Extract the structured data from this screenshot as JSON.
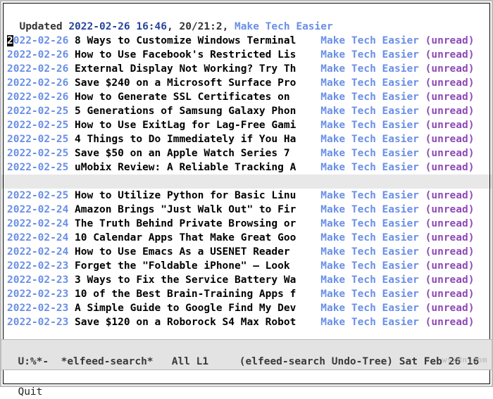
{
  "header": {
    "label": "Updated",
    "timestamp": "2022-02-26 16:46",
    "count": "20/21:2",
    "feed": "Make Tech Easier"
  },
  "columns": {
    "date": 10,
    "title": 40,
    "feed": 17
  },
  "entries": [
    {
      "date": "2022-02-26",
      "title": "8 Ways to Customize Windows Terminal",
      "feed": "Make Tech Easier",
      "status": "(unread)"
    },
    {
      "date": "2022-02-26",
      "title": "How to Use Facebook's Restricted Lis",
      "feed": "Make Tech Easier",
      "status": "(unread)"
    },
    {
      "date": "2022-02-26",
      "title": "External Display Not Working? Try Th",
      "feed": "Make Tech Easier",
      "status": "(unread)"
    },
    {
      "date": "2022-02-26",
      "title": "Save $240 on a Microsoft Surface Pro",
      "feed": "Make Tech Easier",
      "status": "(unread)"
    },
    {
      "date": "2022-02-26",
      "title": "How to Generate SSL Certificates on",
      "feed": "Make Tech Easier",
      "status": "(unread)"
    },
    {
      "date": "2022-02-25",
      "title": "5 Generations of Samsung Galaxy Phon",
      "feed": "Make Tech Easier",
      "status": "(unread)"
    },
    {
      "date": "2022-02-25",
      "title": "How to Use ExitLag for Lag-Free Gami",
      "feed": "Make Tech Easier",
      "status": "(unread)"
    },
    {
      "date": "2022-02-25",
      "title": "4 Things to Do Immediately if You Ha",
      "feed": "Make Tech Easier",
      "status": "(unread)"
    },
    {
      "date": "2022-02-25",
      "title": "Save $50 on an Apple Watch Series 7",
      "feed": "Make Tech Easier",
      "status": "(unread)"
    },
    {
      "date": "2022-02-25",
      "title": "uMobix Review: A Reliable Tracking A",
      "feed": "Make Tech Easier",
      "status": "(unread)"
    }
  ],
  "selected_gap": true,
  "entries2": [
    {
      "date": "2022-02-25",
      "title": "How to Utilize Python for Basic Linu",
      "feed": "Make Tech Easier",
      "status": "(unread)"
    },
    {
      "date": "2022-02-24",
      "title": "Amazon Brings \"Just Walk Out\" to Fir",
      "feed": "Make Tech Easier",
      "status": "(unread)"
    },
    {
      "date": "2022-02-24",
      "title": "The Truth Behind Private Browsing or",
      "feed": "Make Tech Easier",
      "status": "(unread)"
    },
    {
      "date": "2022-02-24",
      "title": "10 Calendar Apps That Make Great Goo",
      "feed": "Make Tech Easier",
      "status": "(unread)"
    },
    {
      "date": "2022-02-24",
      "title": "How to Use Emacs As a USENET Reader",
      "feed": "Make Tech Easier",
      "status": "(unread)"
    },
    {
      "date": "2022-02-23",
      "title": "Forget the \"Foldable iPhone\" — Look",
      "feed": "Make Tech Easier",
      "status": "(unread)"
    },
    {
      "date": "2022-02-23",
      "title": "3 Ways to Fix the Service Battery Wa",
      "feed": "Make Tech Easier",
      "status": "(unread)"
    },
    {
      "date": "2022-02-23",
      "title": "10 of the Best Brain-Training Apps f",
      "feed": "Make Tech Easier",
      "status": "(unread)"
    },
    {
      "date": "2022-02-23",
      "title": "A Simple Guide to Google Find My Dev",
      "feed": "Make Tech Easier",
      "status": "(unread)"
    },
    {
      "date": "2022-02-23",
      "title": "Save $120 on a Roborock S4 Max Robot",
      "feed": "Make Tech Easier",
      "status": "(unread)"
    }
  ],
  "modeline": {
    "left": "U:%*-",
    "buffer": "*elfeed-search*",
    "pos": "All L1",
    "modes": "(elfeed-search Undo-Tree)",
    "clock": "Sat Feb 26 16"
  },
  "minibuffer": "Quit",
  "watermark": "wsxdn.com"
}
